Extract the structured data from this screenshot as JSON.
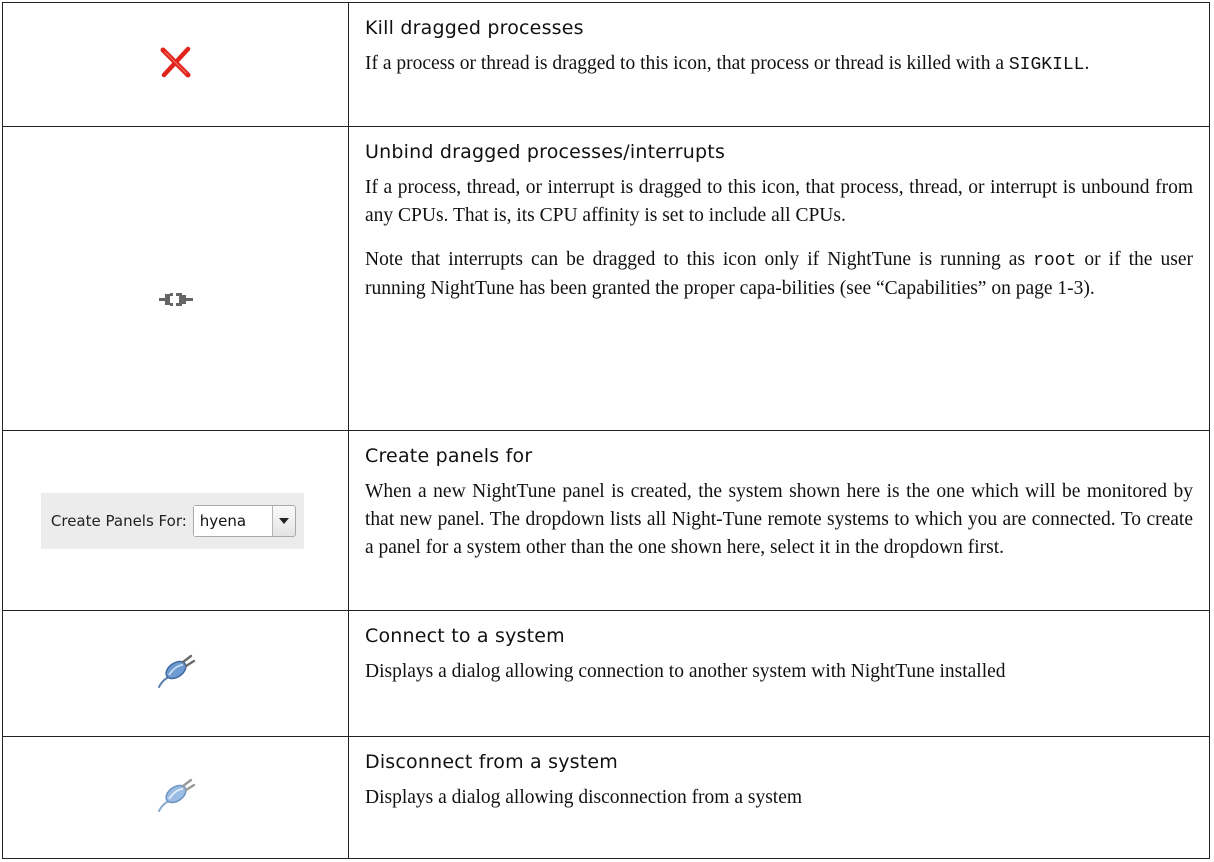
{
  "rows": [
    {
      "icon": "kill-x-icon",
      "title": "Kill dragged processes",
      "body": [
        {
          "p1": "If a process or thread is dragged to this icon, that process or thread is killed with a ",
          "code": "SIGKILL",
          "p2": "."
        }
      ]
    },
    {
      "icon": "unbind-plug-icon",
      "title": "Unbind dragged processes/interrupts",
      "body": [
        {
          "text": "If a process, thread, or interrupt is dragged to this icon, that process, thread, or interrupt is unbound from any CPUs. That is, its CPU affinity is set to include all CPUs."
        },
        {
          "p1": "Note that interrupts can be dragged to this icon only if NightTune is running as ",
          "code": "root",
          "p2": " or if the user running NightTune has been granted the proper capa-bilities (see “Capabilities” on page 1-3)."
        }
      ]
    },
    {
      "icon": "create-panels-for-dropdown",
      "widget": {
        "label": "Create Panels For:",
        "selected": "hyena"
      },
      "title": "Create panels for",
      "body": [
        {
          "text": "When a new NightTune panel is created, the system shown here is the one which will be monitored by that new panel.  The dropdown lists all Night-Tune remote systems to which you are connected. To create a panel for a system other than the one shown here, select it in the dropdown first."
        }
      ]
    },
    {
      "icon": "connect-plug-icon",
      "title": "Connect to a system",
      "body": [
        {
          "text": "Displays a dialog allowing connection to another system with NightTune installed"
        }
      ]
    },
    {
      "icon": "disconnect-plug-icon",
      "title": "Disconnect from a system",
      "body": [
        {
          "text": "Displays a dialog allowing disconnection from a system"
        }
      ]
    }
  ],
  "colors": {
    "kill_red": "#e0241b",
    "plug_blue": "#6e9bd1",
    "border": "#222222"
  }
}
